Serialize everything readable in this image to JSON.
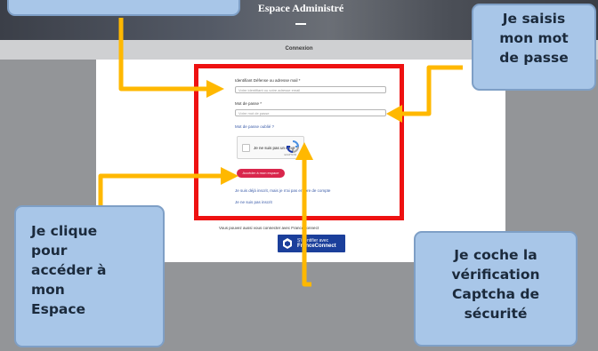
{
  "header": {
    "title": "Espace Administré"
  },
  "connexion_label": "Connexion",
  "form": {
    "identifier_label": "Identifiant Défense ou adresse mail *",
    "identifier_placeholder": "Votre identifiant ou votre adresse email",
    "password_label": "Mot de passe *",
    "password_placeholder": "Votre mot de passe",
    "forgot_password": "Mot de passe oublié ?",
    "captcha_label": "Je ne suis pas un robot",
    "captcha_footer": "reCAPTCHA",
    "submit_label": "Accéder à mon espace",
    "link_no_account": "Je suis déjà inscrit, mais je n'ai pas encore de compte",
    "link_not_registered": "Je ne suis pas inscrit"
  },
  "franceconnect": {
    "text": "Vous pouvez aussi vous connecter avec FranceConnect",
    "button_line1": "S'identifier avec",
    "button_line2": "FranceConnect"
  },
  "callouts": {
    "password": [
      "Je saisis",
      "mon mot",
      "de passe"
    ],
    "access": [
      "Je clique",
      "pour",
      "accéder à",
      "mon",
      "Espace"
    ],
    "captcha": [
      "Je coche la",
      "vérification",
      "Captcha de",
      "sécurité"
    ]
  },
  "colors": {
    "highlight_red": "#ee1111",
    "arrow_yellow": "#ffb800",
    "callout_blue": "#a8c6e8",
    "submit_red": "#d9264c",
    "franceconnect_blue": "#1b3f9b"
  }
}
